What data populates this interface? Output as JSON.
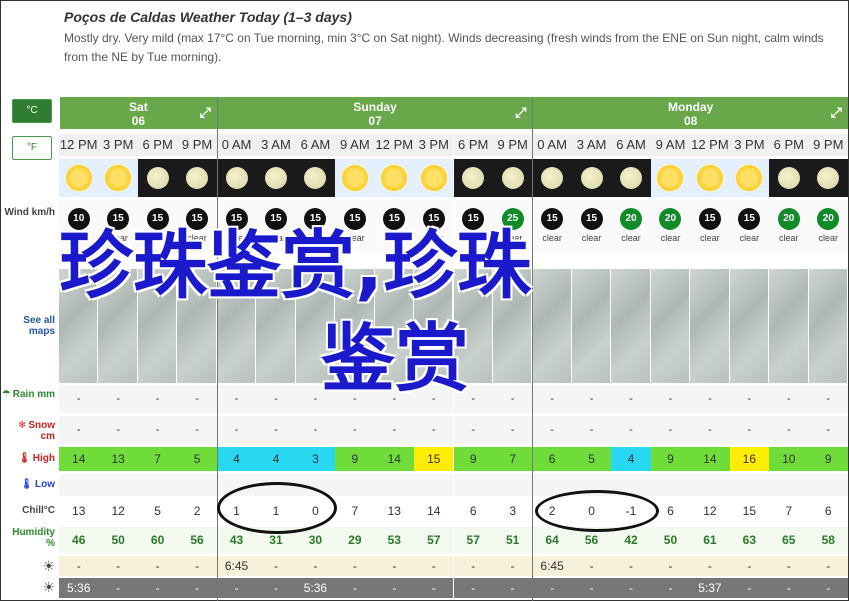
{
  "header": {
    "title": "Poços de Caldas Weather Today (1–3 days)",
    "summary": "Mostly dry. Very mild (max 17°C on Tue morning, min 3°C on Sat night). Winds decreasing (fresh winds from the ENE on Sun night, calm winds from the NE by Tue morning)."
  },
  "units": {
    "celsius": "°C",
    "fahrenheit": "°F"
  },
  "labels": {
    "wind": "Wind km/h",
    "maps": "See all maps",
    "rain": "Rain mm",
    "snow": "Snow cm",
    "high": "High",
    "low": "Low",
    "chill": "Chill°C",
    "humidity": "Humidity %"
  },
  "days": [
    {
      "name": "Sat",
      "date": "06"
    },
    {
      "name": "Sunday",
      "date": "07"
    },
    {
      "name": "Monday",
      "date": "08"
    }
  ],
  "hours": [
    "12 PM",
    "3 PM",
    "6 PM",
    "9 PM",
    "0 AM",
    "3 AM",
    "6 AM",
    "9 AM",
    "12 PM",
    "3 PM",
    "6 PM",
    "9 PM",
    "0 AM",
    "3 AM",
    "6 AM",
    "9 AM",
    "12 PM",
    "3 PM",
    "6 PM",
    "9 PM"
  ],
  "sky": [
    "sun",
    "sun",
    "moon",
    "moon",
    "moon",
    "moon",
    "moon",
    "sun",
    "sun",
    "sun",
    "moon",
    "moon",
    "moon",
    "moon",
    "moon",
    "sun",
    "sun",
    "sun",
    "moon",
    "moon"
  ],
  "wind": [
    "10",
    "15",
    "15",
    "15",
    "15",
    "15",
    "15",
    "15",
    "15",
    "15",
    "15",
    "25",
    "15",
    "15",
    "20",
    "20",
    "15",
    "15",
    "20",
    "20"
  ],
  "wind_cond": [
    "clear",
    "clear",
    "clear",
    "clear",
    "clear",
    "clear",
    "clear",
    "clear",
    "clear",
    "clear",
    "clear",
    "clear",
    "clear",
    "clear",
    "clear",
    "clear",
    "clear",
    "clear",
    "clear",
    "clear"
  ],
  "rain": [
    "-",
    "-",
    "-",
    "-",
    "-",
    "-",
    "-",
    "-",
    "-",
    "-",
    "-",
    "-",
    "-",
    "-",
    "-",
    "-",
    "-",
    "-",
    "-",
    "-"
  ],
  "snow": [
    "-",
    "-",
    "-",
    "-",
    "-",
    "-",
    "-",
    "-",
    "-",
    "-",
    "-",
    "-",
    "-",
    "-",
    "-",
    "-",
    "-",
    "-",
    "-",
    "-"
  ],
  "high": [
    "14",
    "13",
    "7",
    "5",
    "4",
    "4",
    "3",
    "9",
    "14",
    "15",
    "9",
    "7",
    "6",
    "5",
    "4",
    "9",
    "14",
    "16",
    "10",
    "9"
  ],
  "high_colors": [
    "#6fdc3a",
    "#6fdc3a",
    "#6fdc3a",
    "#6fdc3a",
    "#27d8f0",
    "#27d8f0",
    "#27d8f0",
    "#6fdc3a",
    "#6fdc3a",
    "#ffee00",
    "#6fdc3a",
    "#6fdc3a",
    "#6fdc3a",
    "#6fdc3a",
    "#27d8f0",
    "#6fdc3a",
    "#6fdc3a",
    "#ffee00",
    "#6fdc3a",
    "#6fdc3a"
  ],
  "chill": [
    "13",
    "12",
    "5",
    "2",
    "1",
    "1",
    "0",
    "7",
    "13",
    "14",
    "6",
    "3",
    "2",
    "0",
    "-1",
    "6",
    "12",
    "15",
    "7",
    "6"
  ],
  "humidity": [
    "46",
    "50",
    "60",
    "56",
    "43",
    "31",
    "30",
    "29",
    "53",
    "57",
    "57",
    "51",
    "64",
    "56",
    "42",
    "50",
    "61",
    "63",
    "65",
    "58"
  ],
  "sunrise": [
    "-",
    "-",
    "-",
    "-",
    "6:45",
    "-",
    "-",
    "-",
    "-",
    "-",
    "-",
    "-",
    "6:45",
    "-",
    "-",
    "-",
    "-",
    "-",
    "-",
    "-"
  ],
  "sunset": [
    "5:36",
    "-",
    "-",
    "-",
    "-",
    "-",
    "5:36",
    "-",
    "-",
    "-",
    "-",
    "-",
    "-",
    "-",
    "-",
    "-",
    "5:37",
    "-",
    "-",
    "-"
  ],
  "watermark": {
    "line1": "珍珠鉴赏,珍珠",
    "line2": "鉴赏"
  }
}
